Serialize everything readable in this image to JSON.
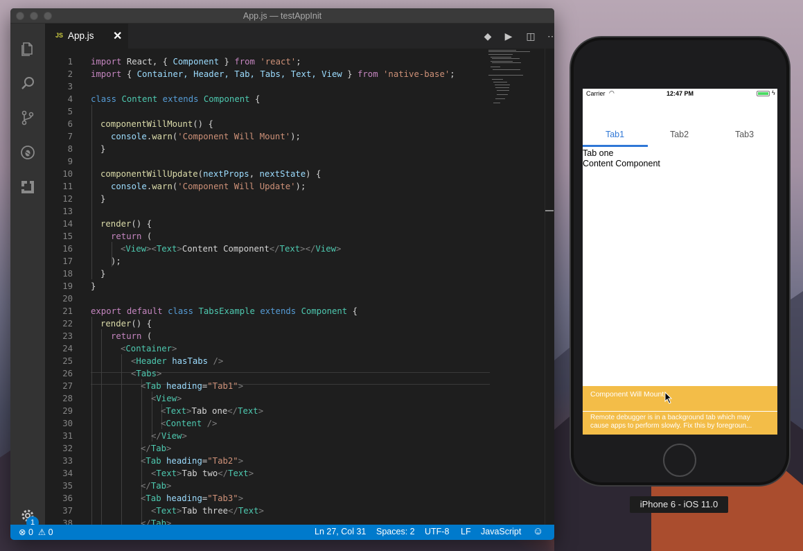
{
  "window": {
    "title": "App.js — testAppInit"
  },
  "tab": {
    "lang_badge": "JS",
    "name": "App.js",
    "close": "✕"
  },
  "editor_actions": {
    "git": "◆",
    "run": "▶",
    "split": "◫",
    "more": "⋯"
  },
  "code_lines": [
    {
      "n": "1"
    },
    {
      "n": "2"
    },
    {
      "n": "3"
    },
    {
      "n": "4"
    },
    {
      "n": "5"
    },
    {
      "n": "6"
    },
    {
      "n": "7"
    },
    {
      "n": "8"
    },
    {
      "n": "9"
    },
    {
      "n": "10"
    },
    {
      "n": "11"
    },
    {
      "n": "12"
    },
    {
      "n": "13"
    },
    {
      "n": "14"
    },
    {
      "n": "15"
    },
    {
      "n": "16"
    },
    {
      "n": "17"
    },
    {
      "n": "18"
    },
    {
      "n": "19"
    },
    {
      "n": "20"
    },
    {
      "n": "21"
    },
    {
      "n": "22"
    },
    {
      "n": "23"
    },
    {
      "n": "24"
    },
    {
      "n": "25"
    },
    {
      "n": "26"
    },
    {
      "n": "27"
    },
    {
      "n": "28"
    },
    {
      "n": "29"
    },
    {
      "n": "30"
    },
    {
      "n": "31"
    },
    {
      "n": "32"
    },
    {
      "n": "33"
    },
    {
      "n": "34"
    },
    {
      "n": "35"
    },
    {
      "n": "36"
    },
    {
      "n": "37"
    },
    {
      "n": "38"
    }
  ],
  "code": {
    "l1": [
      "import",
      " React, { ",
      "Component",
      " } ",
      "from",
      " 'react'",
      ";"
    ],
    "l2": [
      "import",
      " { ",
      "Container, Header, Tab, Tabs, Text, View",
      " } ",
      "from",
      " 'native-base'",
      ";"
    ],
    "l4": [
      "class",
      " ",
      "Content",
      " ",
      "extends",
      " ",
      "Component",
      " {"
    ],
    "l6": [
      "componentWillMount",
      "() {"
    ],
    "l7": [
      "console",
      ".",
      "warn",
      "(",
      "'Component Will Mount'",
      ");"
    ],
    "l8": [
      "}"
    ],
    "l10": [
      "componentWillUpdate",
      "(",
      "nextProps",
      ", ",
      "nextState",
      ") {"
    ],
    "l11": [
      "console",
      ".",
      "warn",
      "(",
      "'Component Will Update'",
      ");"
    ],
    "l12": [
      "}"
    ],
    "l14": [
      "render",
      "() {"
    ],
    "l15": [
      "return",
      " ("
    ],
    "l16": [
      "<",
      "View",
      "><",
      "Text",
      ">",
      "Content Component",
      "</",
      "Text",
      "></",
      "View",
      ">"
    ],
    "l17": [
      ");"
    ],
    "l18": [
      "}"
    ],
    "l19": [
      "}"
    ],
    "l21": [
      "export",
      " ",
      "default",
      " ",
      "class",
      " ",
      "TabsExample",
      " ",
      "extends",
      " ",
      "Component",
      " {"
    ],
    "l22": [
      "render",
      "() {"
    ],
    "l23": [
      "return",
      " ("
    ],
    "l24": [
      "<",
      "Container",
      ">"
    ],
    "l25": [
      "<",
      "Header",
      " ",
      "hasTabs",
      " />"
    ],
    "l26": [
      "<",
      "Tabs",
      ">"
    ],
    "l27": [
      "<",
      "Tab",
      " ",
      "heading",
      "=",
      "\"Tab1\"",
      ">"
    ],
    "l28": [
      "<",
      "View",
      ">"
    ],
    "l29": [
      "<",
      "Text",
      ">",
      "Tab one",
      "</",
      "Text",
      ">"
    ],
    "l30": [
      "<",
      "Content",
      " />"
    ],
    "l31": [
      "</",
      "View",
      ">"
    ],
    "l32": [
      "</",
      "Tab",
      ">"
    ],
    "l33": [
      "<",
      "Tab",
      " ",
      "heading",
      "=",
      "\"Tab2\"",
      ">"
    ],
    "l34": [
      "<",
      "Text",
      ">",
      "Tab two",
      "</",
      "Text",
      ">"
    ],
    "l35": [
      "</",
      "Tab",
      ">"
    ],
    "l36": [
      "<",
      "Tab",
      " ",
      "heading",
      "=",
      "\"Tab3\"",
      ">"
    ],
    "l37": [
      "<",
      "Text",
      ">",
      "Tab three",
      "</",
      "Text",
      ">"
    ],
    "l38": [
      "</",
      "Tab",
      ">"
    ]
  },
  "statusbar": {
    "errors": "0",
    "warnings": "0",
    "position": "Ln 27, Col 31",
    "spaces": "Spaces: 2",
    "encoding": "UTF-8",
    "eol": "LF",
    "language": "JavaScript",
    "feedback": "☺"
  },
  "activity": {
    "badge": "1"
  },
  "phone": {
    "carrier": "Carrier",
    "time": "12:47 PM",
    "tabs": [
      {
        "label": "Tab1"
      },
      {
        "label": "Tab2"
      },
      {
        "label": "Tab3"
      }
    ],
    "content_line1": "Tab one",
    "content_line2": "Content Component",
    "warning1": "Component Will Mount",
    "warning2": "Remote debugger is in a background tab which may cause apps to perform slowly. Fix this by foregroun..."
  },
  "device_label": "iPhone 6 - iOS 11.0",
  "colors": {
    "accent": "#007acc",
    "warning": "#f3bd48",
    "tab_active": "#2f77d6"
  }
}
